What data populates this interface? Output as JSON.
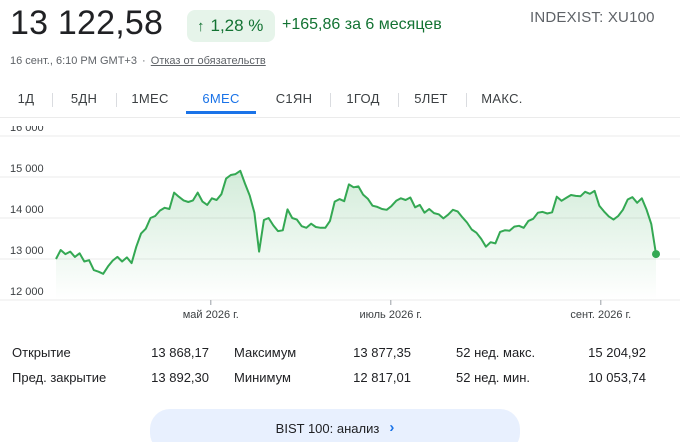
{
  "header": {
    "price": "13 122,58",
    "change_percent": "1,28 %",
    "change_arrow_icon": "arrow-up-icon",
    "change_text": "+165,86 за 6 месяцев",
    "ticker": "INDEXIST: XU100",
    "timestamp": "16 сент., 6:10 PM GMT+3",
    "separator": "·",
    "disclaimer": "Отказ от обязательств"
  },
  "tabs": [
    {
      "label": "1Д",
      "active": false
    },
    {
      "label": "5ДН",
      "active": false
    },
    {
      "label": "1МЕС",
      "active": false
    },
    {
      "label": "6МЕС",
      "active": true
    },
    {
      "label": "С1ЯН",
      "active": false
    },
    {
      "label": "1ГОД",
      "active": false
    },
    {
      "label": "5ЛЕТ",
      "active": false
    },
    {
      "label": "МАКС.",
      "active": false
    }
  ],
  "chart_data": {
    "type": "area",
    "y_tick_labels": [
      "16 000",
      "15 000",
      "14 000",
      "13 000",
      "12 000"
    ],
    "y_ticks": [
      16000,
      15000,
      14000,
      13000,
      12000
    ],
    "ylim": [
      12000,
      16000
    ],
    "x_tick_labels": [
      "май 2026 г.",
      "июль 2026 г.",
      "сент. 2026 г."
    ],
    "x_tick_positions": [
      0.258,
      0.558,
      0.908
    ],
    "grid": true,
    "line_color": "#34a853",
    "fill_color": "#e6f4ea",
    "values": [
      13000,
      13220,
      13120,
      13180,
      13050,
      13140,
      12940,
      12970,
      12730,
      12690,
      12640,
      12820,
      12960,
      13050,
      12940,
      13040,
      12900,
      13300,
      13620,
      13740,
      14000,
      14050,
      14180,
      14250,
      14220,
      14620,
      14520,
      14430,
      14390,
      14430,
      14620,
      14400,
      14320,
      14480,
      14440,
      14580,
      14960,
      15050,
      15070,
      15150,
      14840,
      14550,
      14130,
      13180,
      13950,
      14000,
      13820,
      13680,
      13700,
      14210,
      14000,
      13960,
      13800,
      13760,
      13860,
      13780,
      13760,
      13760,
      13930,
      14400,
      14460,
      14410,
      14820,
      14750,
      14770,
      14570,
      14470,
      14300,
      14270,
      14220,
      14200,
      14290,
      14420,
      14480,
      14440,
      14500,
      14260,
      14320,
      14130,
      14220,
      14120,
      14090,
      13990,
      14080,
      14200,
      14160,
      14020,
      13890,
      13720,
      13640,
      13490,
      13300,
      13410,
      13380,
      13660,
      13700,
      13690,
      13790,
      13810,
      13760,
      13930,
      13980,
      14130,
      14150,
      14110,
      14140,
      14520,
      14420,
      14490,
      14560,
      14540,
      14530,
      14640,
      14590,
      14660,
      14300,
      14160,
      14040,
      13960,
      14050,
      14200,
      14450,
      14510,
      14370,
      14480,
      14200,
      13850,
      13120
    ]
  },
  "stats": {
    "rows": [
      {
        "l1": "Открытие",
        "v1": "13 868,17",
        "l2": "Максимум",
        "v2": "13 877,35",
        "l3": "52 нед. макс.",
        "v3": "15 204,92"
      },
      {
        "l1": "Пред. закрытие",
        "v1": "13 892,30",
        "l2": "Минимум",
        "v2": "12 817,01",
        "l3": "52 нед. мин.",
        "v3": "10 053,74"
      }
    ]
  },
  "analysis_button": {
    "label": "BIST 100: анализ",
    "icon": "chevron-right-icon"
  }
}
